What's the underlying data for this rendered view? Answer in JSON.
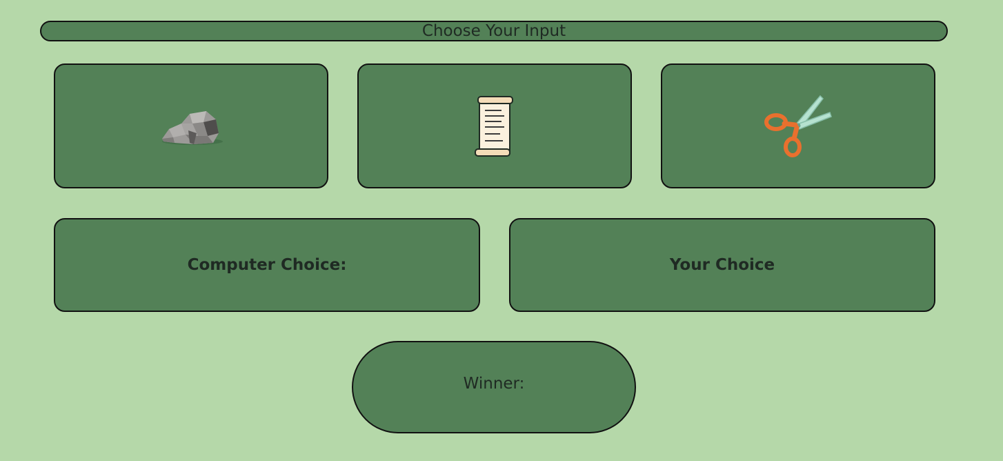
{
  "header": {
    "title": "Choose Your Input"
  },
  "choices": [
    {
      "name": "rock",
      "icon": "rock-icon"
    },
    {
      "name": "paper",
      "icon": "scroll-icon"
    },
    {
      "name": "scissors",
      "icon": "scissors-icon"
    }
  ],
  "results": {
    "computer_label": "Computer Choice:",
    "user_label": "Your Choice"
  },
  "winner": {
    "label": "Winner:"
  },
  "colors": {
    "background": "#b5d8a9",
    "panel": "#538157",
    "border": "#111111",
    "scissors_handle": "#e9702e"
  }
}
